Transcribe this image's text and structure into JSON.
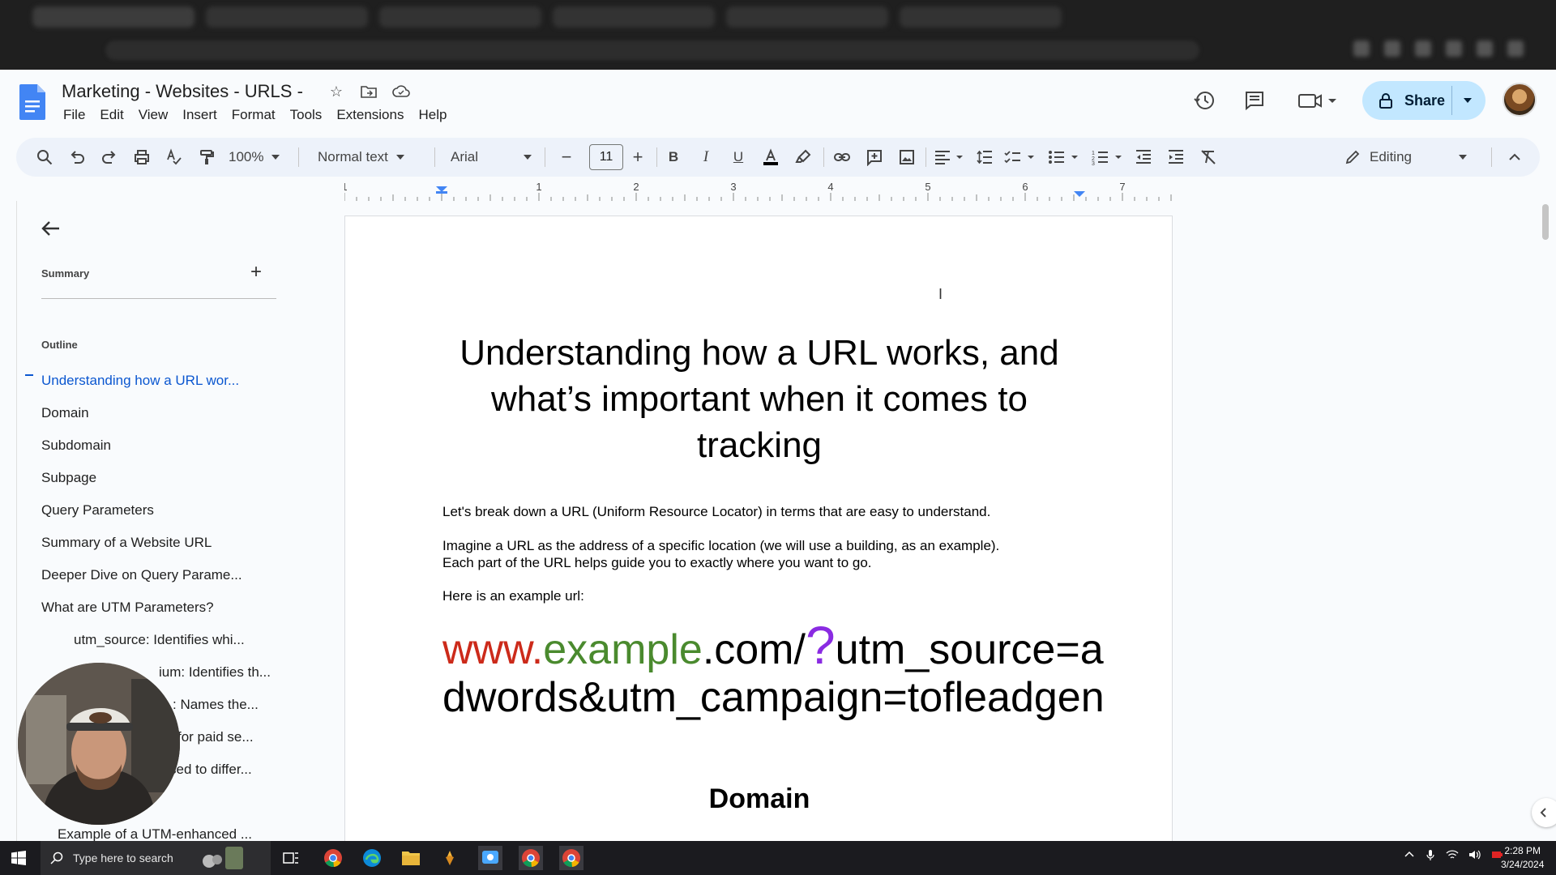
{
  "docs": {
    "title": "Marketing - Websites - URLS -",
    "menus": [
      "File",
      "Edit",
      "View",
      "Insert",
      "Format",
      "Tools",
      "Extensions",
      "Help"
    ],
    "share_label": "Share",
    "editing_label": "Editing"
  },
  "toolbar": {
    "zoom": "100%",
    "style": "Normal text",
    "font": "Arial",
    "font_size": "11"
  },
  "ruler": {
    "ticks": [
      "1",
      "1",
      "2",
      "3",
      "4",
      "5",
      "6",
      "7"
    ]
  },
  "outline_panel": {
    "summary_label": "Summary",
    "outline_label": "Outline",
    "items": [
      "Understanding how a URL wor...",
      "Domain",
      "Subdomain",
      "Subpage",
      "Query Parameters",
      "Summary of a Website URL",
      "Deeper Dive on Query Parame...",
      "What are UTM Parameters?",
      "utm_source: Identifies whi...",
      "ium: Identifies th...",
      ": Names the...",
      "for paid se...",
      "sed to differ...",
      "Example of a UTM-enhanced ..."
    ]
  },
  "document": {
    "heading": "Understanding how a URL works, and what’s important when it comes to tracking",
    "para1": "Let's break down a URL (Uniform Resource Locator) in terms that are easy to understand.",
    "para2_line1": "Imagine a URL as the address of a specific location (we will use a building, as an example).",
    "para2_line2": "Each part of the URL helps guide you to exactly where you want to go.",
    "para3": "Here is an example url:",
    "url_parts": {
      "www": "www.",
      "domain": "example",
      "tld": ".com/",
      "question": "?",
      "query": "utm_source=adwords&utm_campaign=tofleadgen"
    },
    "section_heading": "Domain"
  },
  "taskbar": {
    "search_placeholder": "Type here to search",
    "time": "2:28 PM",
    "date": "3/24/2024"
  },
  "colors": {
    "url_www": "#cc2a1a",
    "url_domain": "#4a8a2e",
    "url_question": "#8a2be2",
    "share_bg": "#c2e7ff",
    "active_outline": "#0b57d0"
  }
}
